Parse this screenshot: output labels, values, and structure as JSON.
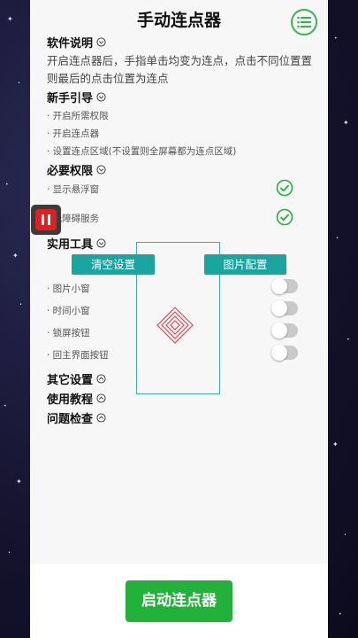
{
  "app": {
    "title": "手动连点器"
  },
  "intro": {
    "heading": "软件说明",
    "text": "开启连点器后，手指单击均变为连点，点击不同位置置则最后的点击位置为连点"
  },
  "guide": {
    "heading": "新手引导",
    "items": [
      "· 开启所需权限",
      "· 开启连点器",
      "· 设置连点区域(不设置则全屏幕都为连点区域)"
    ]
  },
  "permissions": {
    "heading": "必要权限",
    "items": [
      {
        "label": "· 显示悬浮窗",
        "granted": true
      },
      {
        "label": "· 无障碍服务",
        "granted": true
      }
    ]
  },
  "tools": {
    "heading": "实用工具",
    "clear_button": "清空设置",
    "image_button": "图片配置",
    "items": [
      {
        "label": "· 图片小窗",
        "on": false
      },
      {
        "label": "· 时间小窗",
        "on": false
      },
      {
        "label": "· 锁屏按钮",
        "on": false
      },
      {
        "label": "· 回主界面按钮",
        "on": false
      }
    ]
  },
  "collapsed_sections": [
    "其它设置",
    "使用教程",
    "问题检查"
  ],
  "start_button": "启动连点器",
  "colors": {
    "accent_green": "#22b23a",
    "teal": "#1aa6a0",
    "pause_red": "#e02020"
  },
  "icons": {
    "menu": "list-menu-icon",
    "check": "check-circle-icon",
    "pause": "pause-icon",
    "target": "concentric-diamond-target-icon"
  }
}
